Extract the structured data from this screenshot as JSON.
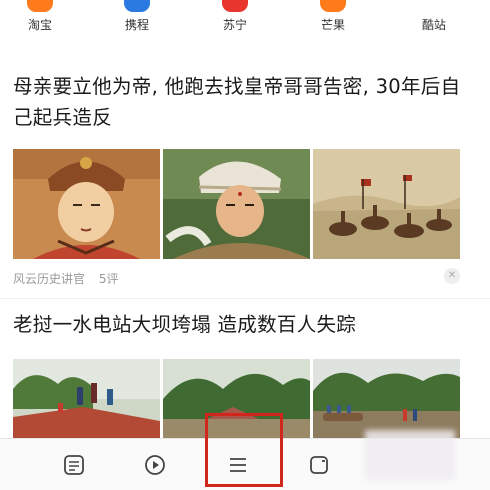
{
  "shortcuts": [
    {
      "label": "淘宝",
      "icon": "taobao-icon",
      "color": "#ff7a1a"
    },
    {
      "label": "携程",
      "icon": "ctrip-icon",
      "color": "#2a7ae2"
    },
    {
      "label": "苏宁",
      "icon": "suning-icon",
      "color": "#e8362f"
    },
    {
      "label": "芒果",
      "icon": "mango-icon",
      "color": "#ff7a1a"
    },
    {
      "label": "酷站",
      "icon": "kuzhan-icon",
      "color": "#ffffff"
    }
  ],
  "articles": [
    {
      "title": "母亲要立他为帝, 他跑去找皇帝哥哥告密, 30年后自己起兵造反",
      "images": [
        "emperor-portrait-image",
        "warrior-illustration-image",
        "battle-painting-image"
      ],
      "source": "风云历史讲官",
      "comments": "5评"
    },
    {
      "title": "老挝一水电站大坝垮塌 造成数百人失踪",
      "images": [
        "flood-rooftop-image",
        "flood-village-image",
        "flood-boats-image"
      ]
    }
  ],
  "bottom_nav": [
    {
      "icon": "news-icon"
    },
    {
      "icon": "video-icon"
    },
    {
      "icon": "menu-icon"
    },
    {
      "icon": "tabs-icon"
    },
    {
      "icon": "profile-icon"
    }
  ],
  "colors": {
    "highlight": "#d0261b",
    "source_text": "#9a9a9a"
  }
}
